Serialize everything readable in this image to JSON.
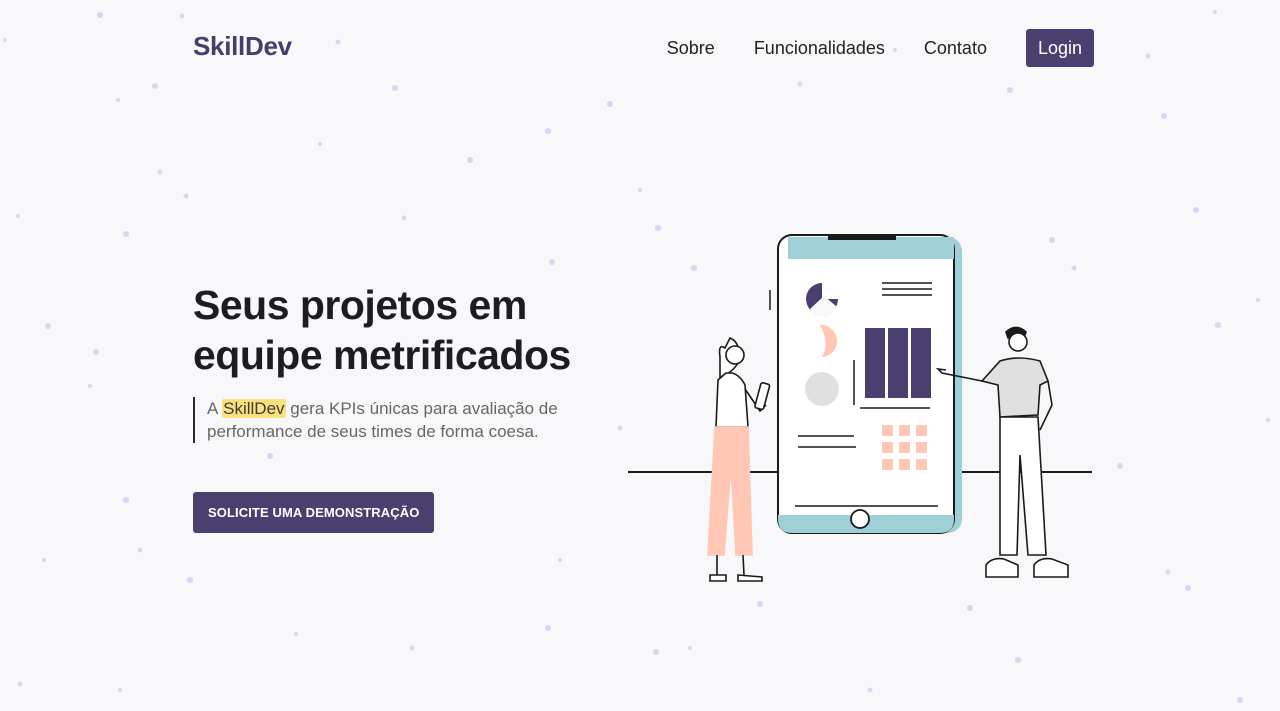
{
  "brand": {
    "name": "SkillDev",
    "color": "#473d6b"
  },
  "nav": {
    "links": [
      {
        "label": "Sobre"
      },
      {
        "label": "Funcionalidades"
      },
      {
        "label": "Contato"
      }
    ],
    "login_label": "Login"
  },
  "hero": {
    "title_line1": "Seus projetos em",
    "title_line2": "equipe metrificados",
    "desc_prefix": "A ",
    "desc_highlight": "SkillDev",
    "desc_rest": " gera KPIs únicas para avaliação de performance de seus times de forma coesa.",
    "cta_label": "SOLICITE UMA DEMONSTRAÇÃO"
  },
  "colors": {
    "primary": "#4b3f70",
    "highlight": "#f9e27d",
    "phone_accent": "#9fd0d7",
    "peach": "#ffc7b4",
    "background": "#f8f8fa"
  }
}
